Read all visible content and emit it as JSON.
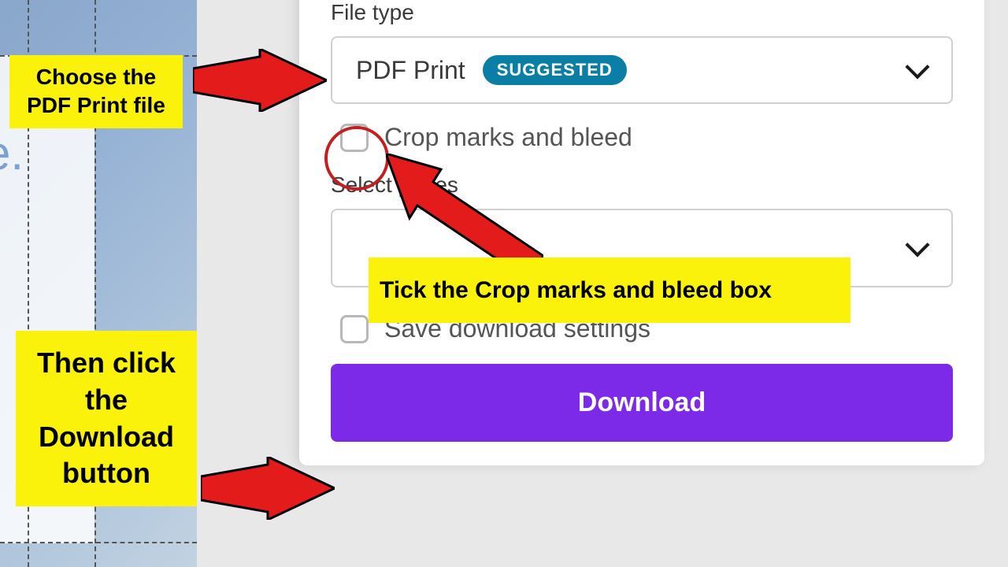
{
  "panel": {
    "file_type_label": "File type",
    "file_type_dropdown": {
      "value": "PDF Print",
      "badge": "SUGGESTED"
    },
    "crop_marks_label": "Crop marks and bleed",
    "select_pages_label": "Select pages",
    "save_settings_label": "Save download settings",
    "download_button": "Download"
  },
  "annotations": {
    "callout1": "Choose the PDF Print file",
    "callout2": "Then click the Download button",
    "callout3": "Tick the Crop marks and bleed box"
  },
  "canvas": {
    "sample_text": "e."
  }
}
